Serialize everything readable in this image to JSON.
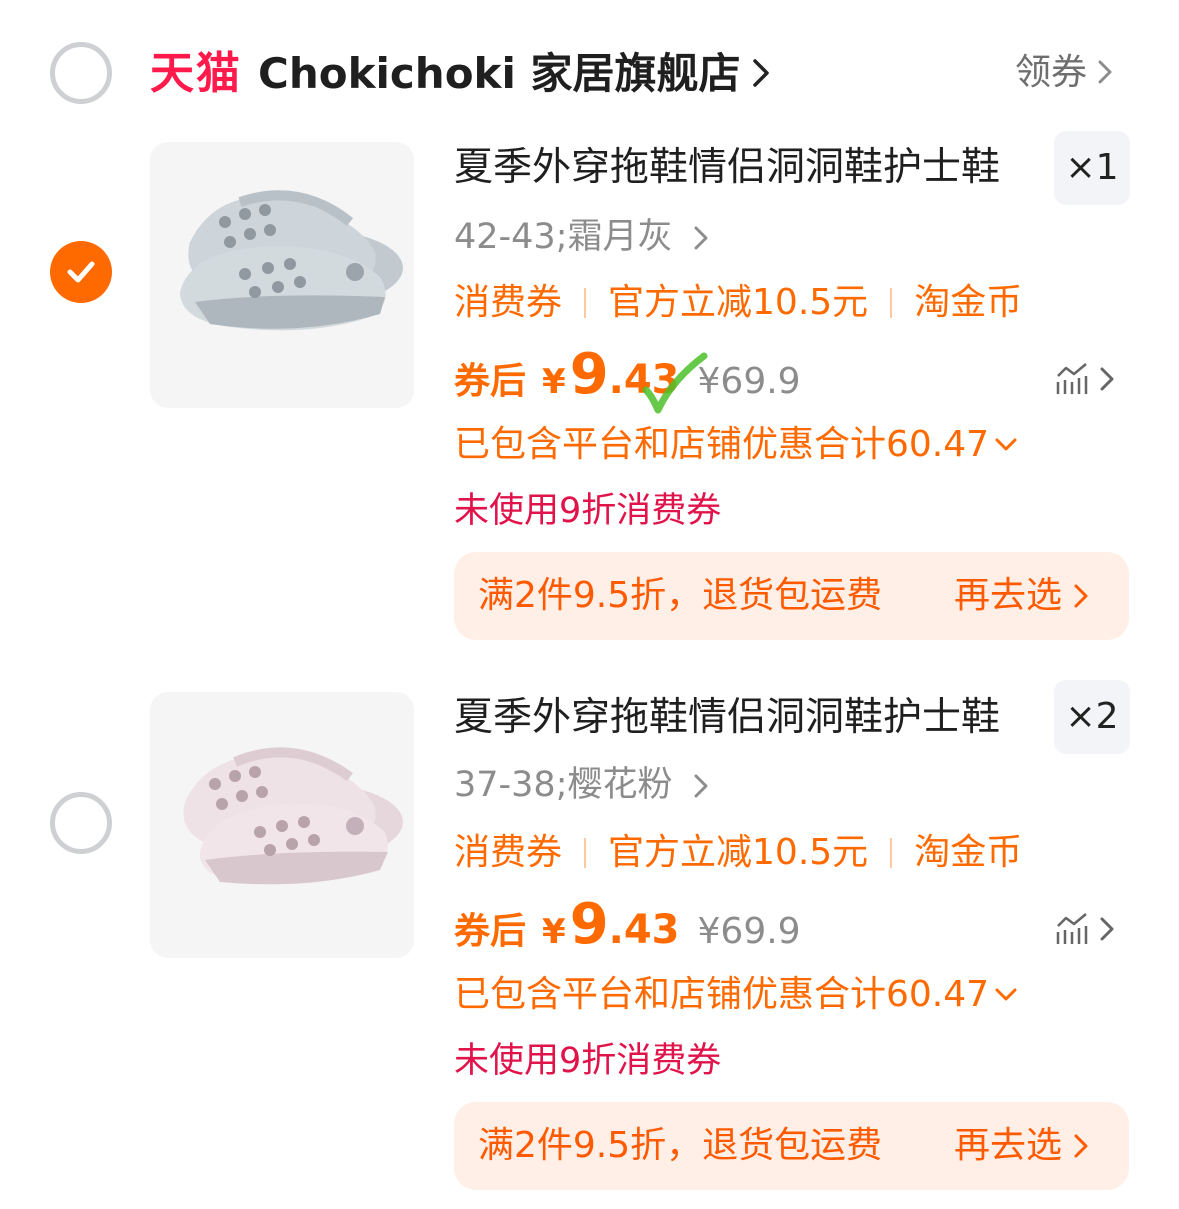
{
  "shop": {
    "platform_logo": "天猫",
    "name": "Chokichoki 家居旗舰店",
    "coupon_link": "领券",
    "selected": false
  },
  "items": [
    {
      "selected": true,
      "title": "夏季外穿拖鞋情侣洞洞鞋护士鞋",
      "quantity": "×1",
      "sku": "42-43;霜月灰",
      "tags": [
        "消费券",
        "官方立减10.5元",
        "淘金币"
      ],
      "price_prefix": "券后",
      "price_symbol": "¥",
      "price_int": "9",
      "price_dec": ".43",
      "original_price": "¥69.9",
      "discount_total": "已包含平台和店铺优惠合计60.47",
      "unused_coupon": "未使用9折消费券",
      "promo_text": "满2件9.5折，退货包运费",
      "promo_action": "再去选",
      "shoe_color": "#c8d0d6"
    },
    {
      "selected": false,
      "title": "夏季外穿拖鞋情侣洞洞鞋护士鞋",
      "quantity": "×2",
      "sku": "37-38;樱花粉",
      "tags": [
        "消费券",
        "官方立减10.5元",
        "淘金币"
      ],
      "price_prefix": "券后",
      "price_symbol": "¥",
      "price_int": "9",
      "price_dec": ".43",
      "original_price": "¥69.9",
      "discount_total": "已包含平台和店铺优惠合计60.47",
      "unused_coupon": "未使用9折消费券",
      "promo_text": "满2件9.5折，退货包运费",
      "promo_action": "再去选",
      "shoe_color": "#ecdde3"
    }
  ],
  "colors": {
    "accent_orange": "#ff6a00",
    "tmall_red": "#ff1a4b",
    "unused_red": "#e0134a",
    "promo_bg": "#ffefe6",
    "annotation_green": "#4cbf2a"
  }
}
